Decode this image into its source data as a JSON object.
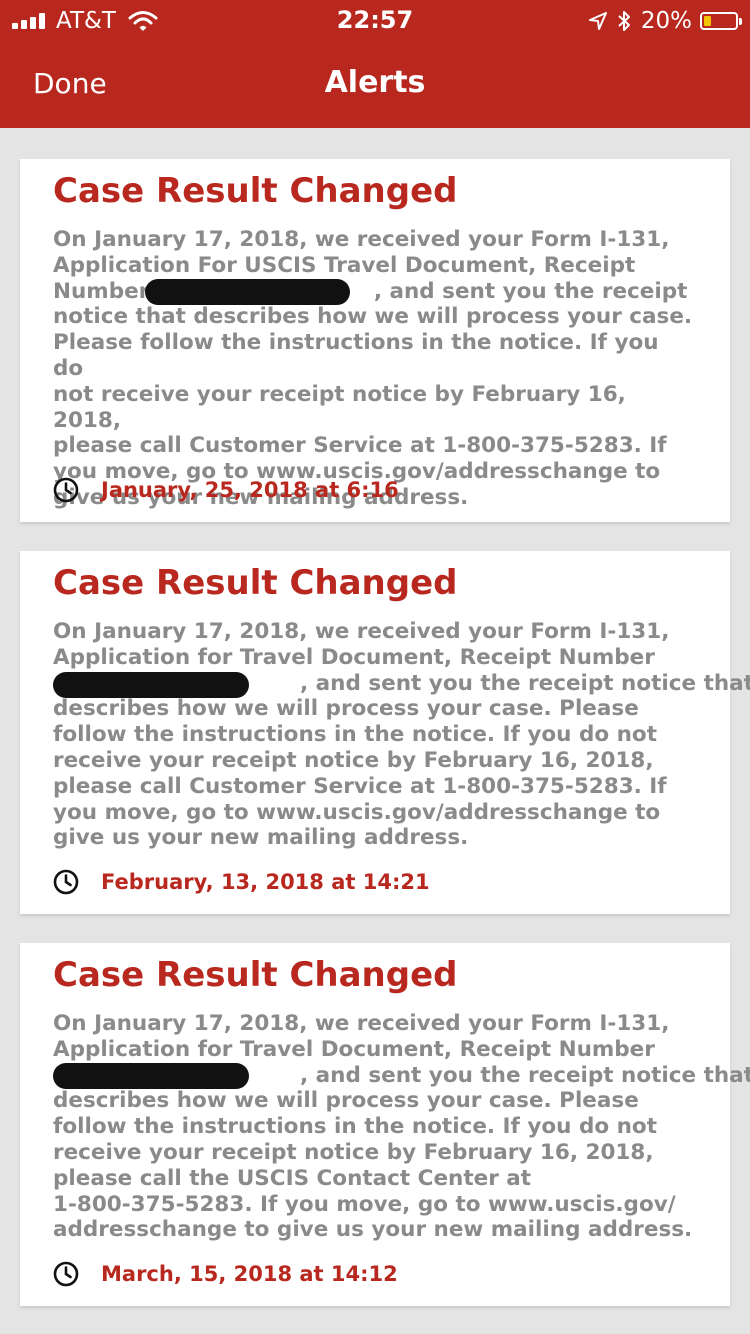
{
  "status_bar": {
    "carrier": "AT&T",
    "time": "22:57",
    "battery": "20%"
  },
  "nav": {
    "done_label": "Done",
    "title": "Alerts"
  },
  "alerts": [
    {
      "title": "Case Result Changed",
      "lines": [
        "On January 17, 2018, we received your Form I-131,",
        "Application For USCIS Travel Document, Receipt",
        "Number                              , and sent you the receipt",
        "notice that describes how we will process your case.",
        "Please follow the instructions in the notice. If you do",
        "not receive your receipt notice by February 16, 2018,",
        "please call Customer Service at 1-800-375-5283. If",
        "you move, go to www.uscis.gov/addresschange to",
        "give us your new mailing address."
      ],
      "timestamp": "January, 25, 2018 at 6:16"
    },
    {
      "title": "Case Result Changed",
      "lines": [
        "On January 17, 2018, we received your Form I-131,",
        "Application for Travel Document, Receipt Number",
        "                                 , and sent you the receipt notice that",
        "describes how we will process your case. Please",
        "follow the instructions in the notice. If you do not",
        "receive your receipt notice by February 16, 2018,",
        "please call Customer Service at 1-800-375-5283. If",
        "you move, go to www.uscis.gov/addresschange to",
        "give us your new mailing address."
      ],
      "timestamp": "February, 13, 2018 at 14:21"
    },
    {
      "title": "Case Result Changed",
      "lines": [
        "On January 17, 2018, we received your Form I-131,",
        "Application for Travel Document, Receipt Number",
        "                                 , and sent you the receipt notice that",
        "describes how we will process your case. Please",
        "follow the instructions in the notice. If you do not",
        "receive your receipt notice by February 16, 2018,",
        "please call the USCIS Contact Center at",
        "1-800-375-5283. If you move, go to www.uscis.gov/",
        "addresschange to give us your new mailing address."
      ],
      "timestamp": "March, 15, 2018 at 14:12"
    }
  ],
  "colors": {
    "accent": "#b8281f",
    "body_text": "#8a8a8a",
    "background": "#e4e4e4"
  },
  "icons": {
    "timestamp": "clock-icon"
  }
}
